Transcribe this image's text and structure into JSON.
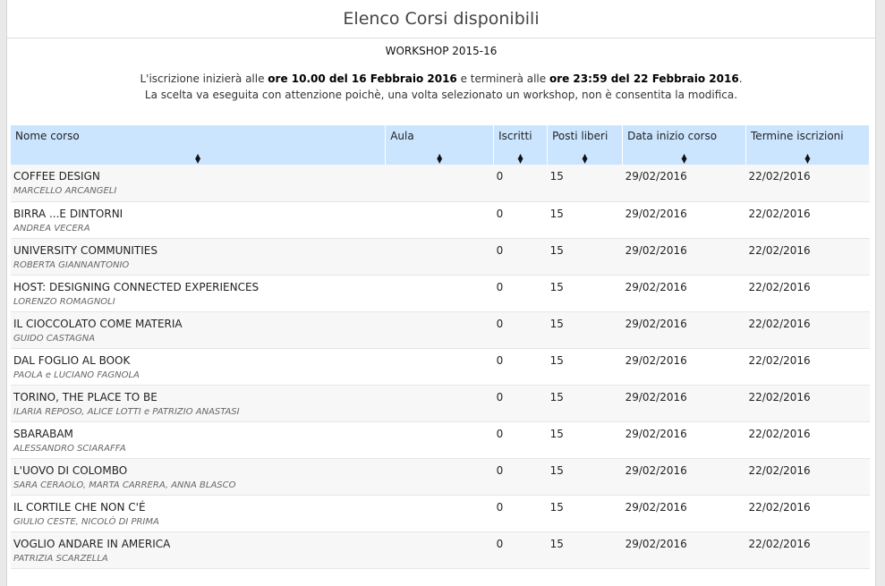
{
  "page": {
    "title": "Elenco Corsi disponibili",
    "subtitle": "WORKSHOP 2015-16",
    "info": {
      "line1_a": "L'iscrizione inizierà alle ",
      "start": "ore 10.00 del 16 Febbraio 2016",
      "line1_b": " e terminerà alle ",
      "end": "ore 23:59 del 22 Febbraio 2016",
      "line1_c": ".",
      "line2": "La scelta va eseguita con attenzione poichè, una volta selezionato un workshop, non è consentita la modifica."
    }
  },
  "table": {
    "headers": [
      "Nome corso",
      "Aula",
      "Iscritti",
      "Posti liberi",
      "Data inizio corso",
      "Termine iscrizioni"
    ],
    "sort_glyph": "▲▼",
    "rows": [
      {
        "name": "COFFEE DESIGN",
        "teacher": "MARCELLO ARCANGELI",
        "aula": "",
        "iscritti": "0",
        "posti": "15",
        "inizio": "29/02/2016",
        "termine": "22/02/2016"
      },
      {
        "name": "BIRRA ...E DINTORNI",
        "teacher": "ANDREA VECERA",
        "aula": "",
        "iscritti": "0",
        "posti": "15",
        "inizio": "29/02/2016",
        "termine": "22/02/2016"
      },
      {
        "name": "UNIVERSITY COMMUNITIES",
        "teacher": "ROBERTA GIANNANTONIO",
        "aula": "",
        "iscritti": "0",
        "posti": "15",
        "inizio": "29/02/2016",
        "termine": "22/02/2016"
      },
      {
        "name": "HOST: DESIGNING CONNECTED EXPERIENCES",
        "teacher": "LORENZO ROMAGNOLI",
        "aula": "",
        "iscritti": "0",
        "posti": "15",
        "inizio": "29/02/2016",
        "termine": "22/02/2016"
      },
      {
        "name": "IL CIOCCOLATO COME MATERIA",
        "teacher": "GUIDO CASTAGNA",
        "aula": "",
        "iscritti": "0",
        "posti": "15",
        "inizio": "29/02/2016",
        "termine": "22/02/2016"
      },
      {
        "name": "DAL FOGLIO AL BOOK",
        "teacher": "PAOLA e LUCIANO FAGNOLA",
        "aula": "",
        "iscritti": "0",
        "posti": "15",
        "inizio": "29/02/2016",
        "termine": "22/02/2016"
      },
      {
        "name": "TORINO, THE PLACE TO BE",
        "teacher": "ILARIA REPOSO, ALICE LOTTI e PATRIZIO ANASTASI",
        "aula": "",
        "iscritti": "0",
        "posti": "15",
        "inizio": "29/02/2016",
        "termine": "22/02/2016"
      },
      {
        "name": "SBARABAM",
        "teacher": "ALESSANDRO SCIARAFFA",
        "aula": "",
        "iscritti": "0",
        "posti": "15",
        "inizio": "29/02/2016",
        "termine": "22/02/2016"
      },
      {
        "name": "L'UOVO DI COLOMBO",
        "teacher": "SARA CERAOLO, MARTA CARRERA, ANNA BLASCO",
        "aula": "",
        "iscritti": "0",
        "posti": "15",
        "inizio": "29/02/2016",
        "termine": "22/02/2016"
      },
      {
        "name": "IL CORTILE CHE NON C'É",
        "teacher": "GIULIO CESTE, NICOLÒ DI PRIMA",
        "aula": "",
        "iscritti": "0",
        "posti": "15",
        "inizio": "29/02/2016",
        "termine": "22/02/2016"
      },
      {
        "name": "VOGLIO ANDARE IN AMERICA",
        "teacher": "PATRIZIA SCARZELLA",
        "aula": "",
        "iscritti": "0",
        "posti": "15",
        "inizio": "29/02/2016",
        "termine": "22/02/2016"
      }
    ]
  },
  "colors": {
    "header_bg": "#cce5ff",
    "row_odd": "#f7f7f7",
    "row_even": "#ffffff"
  }
}
